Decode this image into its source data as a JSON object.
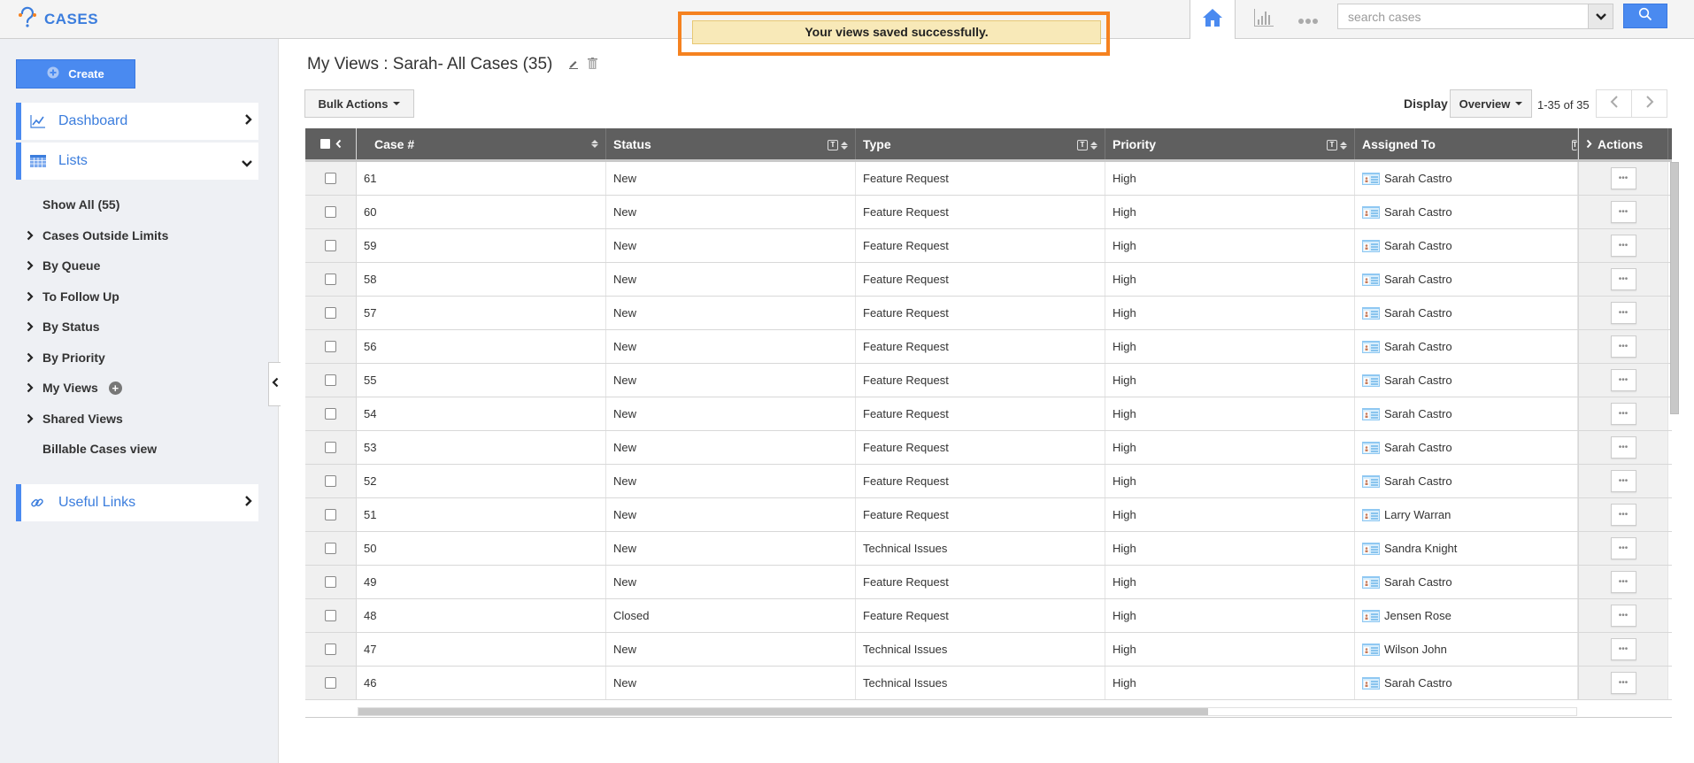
{
  "app": {
    "title": "CASES",
    "logo_icon": "headset-question-icon"
  },
  "notification": {
    "message": "Your views saved successfully."
  },
  "topnav": {
    "home_icon": "home-icon",
    "reports_icon": "bar-chart-icon",
    "more_icon": "more-dots-icon",
    "search_placeholder": "search cases",
    "search_value": "",
    "search_button_icon": "search-icon"
  },
  "sidebar": {
    "create_label": "Create",
    "dashboard_label": "Dashboard",
    "lists_label": "Lists",
    "list_items": [
      {
        "label": "Show All (55)",
        "expandable": false
      },
      {
        "label": "Cases Outside Limits",
        "expandable": true
      },
      {
        "label": "By Queue",
        "expandable": true
      },
      {
        "label": "To Follow Up",
        "expandable": true
      },
      {
        "label": "By Status",
        "expandable": true
      },
      {
        "label": "By Priority",
        "expandable": true
      },
      {
        "label": "My Views",
        "expandable": true,
        "add": true
      },
      {
        "label": "Shared Views",
        "expandable": true
      },
      {
        "label": "Billable Cases view",
        "expandable": false
      }
    ],
    "useful_links_label": "Useful Links"
  },
  "main": {
    "title": "My Views : Sarah- All Cases (35)",
    "bulk_actions_label": "Bulk Actions",
    "display_label": "Display",
    "display_value": "Overview",
    "pager_text": "1-35 of 35",
    "columns": [
      "Case #",
      "Status",
      "Type",
      "Priority",
      "Assigned To",
      "Actions"
    ],
    "rows": [
      {
        "case": "61",
        "status": "New",
        "type": "Feature Request",
        "priority": "High",
        "assigned": "Sarah Castro"
      },
      {
        "case": "60",
        "status": "New",
        "type": "Feature Request",
        "priority": "High",
        "assigned": "Sarah Castro"
      },
      {
        "case": "59",
        "status": "New",
        "type": "Feature Request",
        "priority": "High",
        "assigned": "Sarah Castro"
      },
      {
        "case": "58",
        "status": "New",
        "type": "Feature Request",
        "priority": "High",
        "assigned": "Sarah Castro"
      },
      {
        "case": "57",
        "status": "New",
        "type": "Feature Request",
        "priority": "High",
        "assigned": "Sarah Castro"
      },
      {
        "case": "56",
        "status": "New",
        "type": "Feature Request",
        "priority": "High",
        "assigned": "Sarah Castro"
      },
      {
        "case": "55",
        "status": "New",
        "type": "Feature Request",
        "priority": "High",
        "assigned": "Sarah Castro"
      },
      {
        "case": "54",
        "status": "New",
        "type": "Feature Request",
        "priority": "High",
        "assigned": "Sarah Castro"
      },
      {
        "case": "53",
        "status": "New",
        "type": "Feature Request",
        "priority": "High",
        "assigned": "Sarah Castro"
      },
      {
        "case": "52",
        "status": "New",
        "type": "Feature Request",
        "priority": "High",
        "assigned": "Sarah Castro"
      },
      {
        "case": "51",
        "status": "New",
        "type": "Feature Request",
        "priority": "High",
        "assigned": "Larry Warran"
      },
      {
        "case": "50",
        "status": "New",
        "type": "Technical Issues",
        "priority": "High",
        "assigned": "Sandra Knight"
      },
      {
        "case": "49",
        "status": "New",
        "type": "Feature Request",
        "priority": "High",
        "assigned": "Sarah Castro"
      },
      {
        "case": "48",
        "status": "Closed",
        "type": "Feature Request",
        "priority": "High",
        "assigned": "Jensen Rose"
      },
      {
        "case": "47",
        "status": "New",
        "type": "Technical Issues",
        "priority": "High",
        "assigned": "Wilson John"
      },
      {
        "case": "46",
        "status": "New",
        "type": "Technical Issues",
        "priority": "High",
        "assigned": "Sarah Castro"
      }
    ]
  },
  "colors": {
    "accent": "#4a8af0",
    "header": "#5f5f5f",
    "notify_bg": "#f8e9b8",
    "highlight": "#f58220"
  }
}
